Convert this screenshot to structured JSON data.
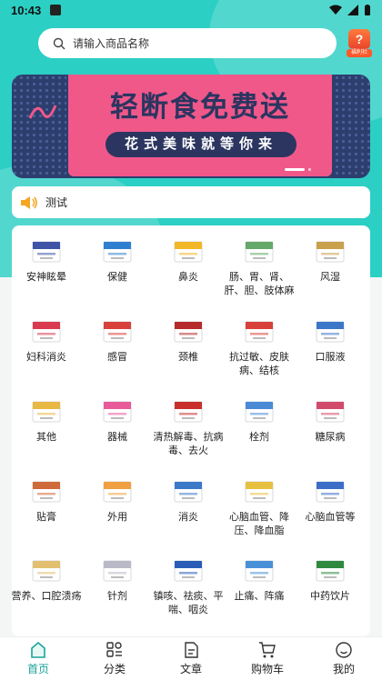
{
  "status": {
    "time": "10:43"
  },
  "search": {
    "placeholder": "请输入商品名称"
  },
  "gift": {
    "label": "福利社",
    "mark": "?"
  },
  "banner": {
    "title": "轻断食免费送",
    "subtitle": "花式美味就等你来"
  },
  "notice": {
    "text": "测试"
  },
  "categories": [
    {
      "label": "安神眩晕",
      "color": "#3e55a6"
    },
    {
      "label": "保健",
      "color": "#2f7fd0"
    },
    {
      "label": "鼻炎",
      "color": "#f2b728"
    },
    {
      "label": "肠、胃、肾、肝、胆、肢体麻",
      "color": "#64a86a"
    },
    {
      "label": "风湿",
      "color": "#c9a04b"
    },
    {
      "label": "妇科消炎",
      "color": "#d93a50"
    },
    {
      "label": "感冒",
      "color": "#d8413a"
    },
    {
      "label": "颈椎",
      "color": "#b52a2a"
    },
    {
      "label": "抗过敏、皮肤病、结核",
      "color": "#d8413a"
    },
    {
      "label": "口服液",
      "color": "#3b77c9"
    },
    {
      "label": "其他",
      "color": "#e8b844"
    },
    {
      "label": "器械",
      "color": "#e85a9a"
    },
    {
      "label": "清热解毒、抗病毒、去火",
      "color": "#c9302c"
    },
    {
      "label": "栓剂",
      "color": "#4a8ad6"
    },
    {
      "label": "糖尿病",
      "color": "#d24a6a"
    },
    {
      "label": "贴膏",
      "color": "#cf6a3a"
    },
    {
      "label": "外用",
      "color": "#f0a040"
    },
    {
      "label": "消炎",
      "color": "#3c78c8"
    },
    {
      "label": "心脑血管、降压、降血脂",
      "color": "#e8c040"
    },
    {
      "label": "心脑血管等",
      "color": "#3c6ec8"
    },
    {
      "label": "营养、口腔溃疡",
      "color": "#e2c070"
    },
    {
      "label": "针剂",
      "color": "#b9b9c8"
    },
    {
      "label": "镇咳、祛痰、平喘、咽炎",
      "color": "#2a5db8"
    },
    {
      "label": "止痛、阵痛",
      "color": "#4a90d8"
    },
    {
      "label": "中药饮片",
      "color": "#2e8a3e"
    }
  ],
  "tabs": [
    {
      "label": "首页",
      "icon": "home-icon",
      "active": true
    },
    {
      "label": "分类",
      "icon": "category-icon",
      "active": false
    },
    {
      "label": "文章",
      "icon": "article-icon",
      "active": false
    },
    {
      "label": "购物车",
      "icon": "cart-icon",
      "active": false
    },
    {
      "label": "我的",
      "icon": "profile-icon",
      "active": false
    }
  ],
  "colors": {
    "accent": "#2ccfc4",
    "active_tab": "#1aa39a",
    "banner_pink": "#f0588a",
    "banner_navy": "#2b3560"
  }
}
